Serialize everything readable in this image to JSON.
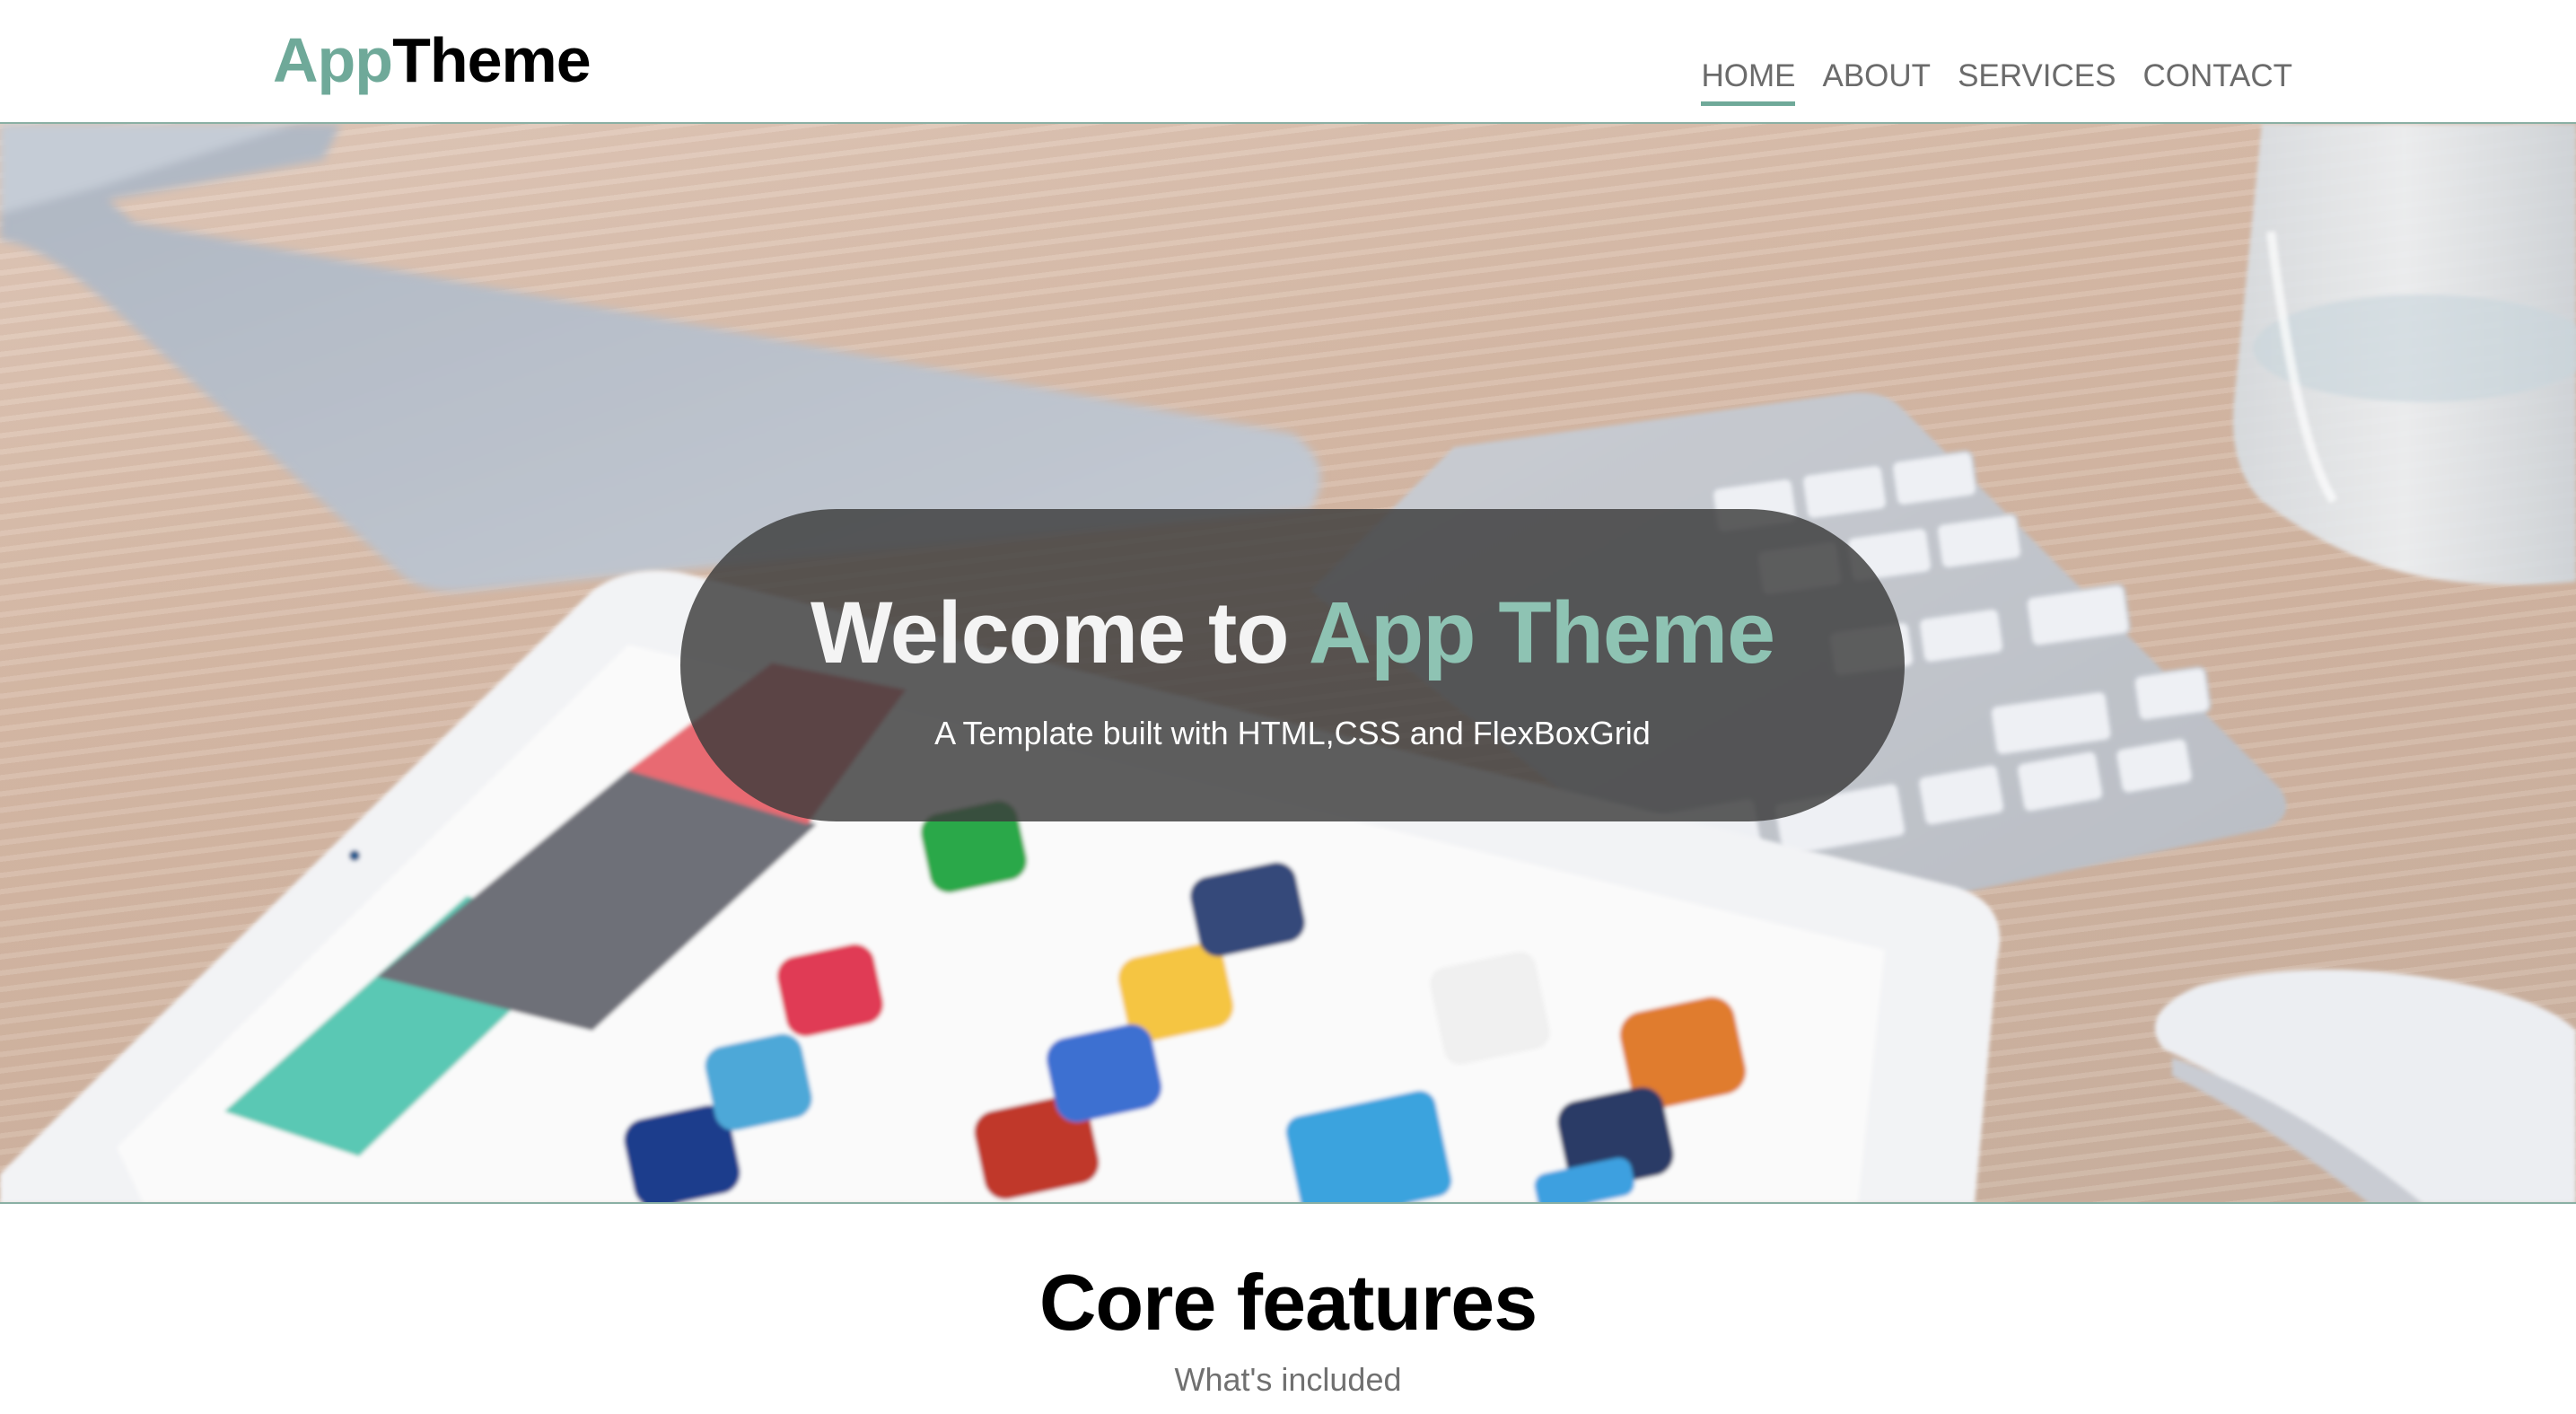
{
  "brand": {
    "logo_part1": "App",
    "logo_part2": "Theme",
    "accent_color": "#6fa999"
  },
  "nav": {
    "items": [
      {
        "label": "HOME",
        "active": true
      },
      {
        "label": "ABOUT",
        "active": false
      },
      {
        "label": "SERVICES",
        "active": false
      },
      {
        "label": "CONTACT",
        "active": false
      }
    ]
  },
  "hero": {
    "title_prefix": "Welcome to ",
    "title_accent": "App Theme",
    "subtitle": "A Template built with HTML,CSS and FlexBoxGrid",
    "background_image": "desk with monitor, keyboard, tablet, mouse and glass"
  },
  "features": {
    "title": "Core features",
    "subtitle": "What's included"
  }
}
